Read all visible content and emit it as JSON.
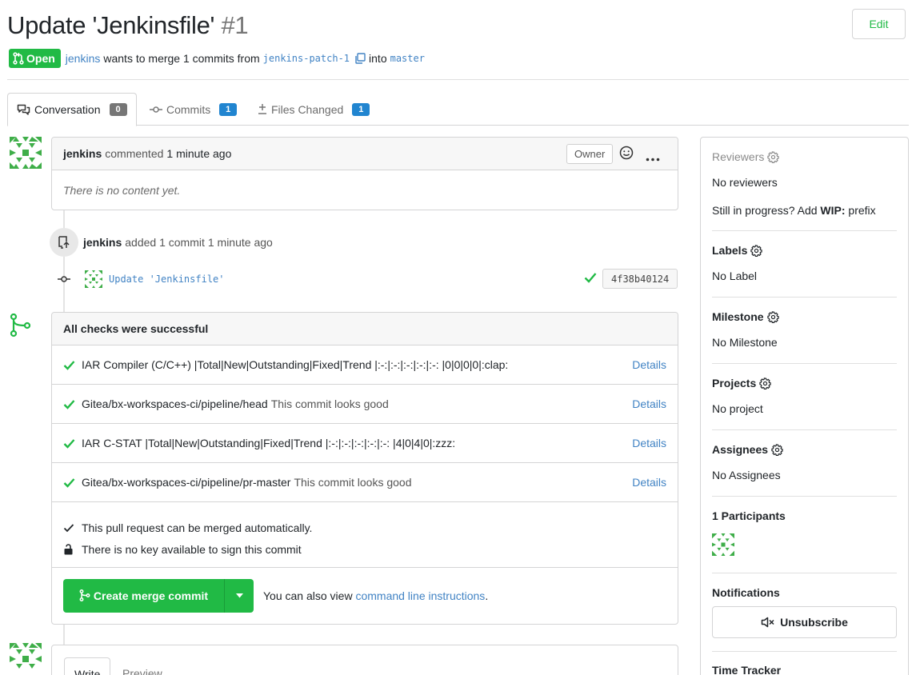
{
  "header": {
    "title": "Update 'Jenkinsfile'",
    "number": "#1",
    "edit_label": "Edit",
    "status": "Open",
    "author": "jenkins",
    "merge_text": "wants to merge 1 commits from",
    "head_branch": "jenkins-patch-1",
    "into_text": "into",
    "base_branch": "master"
  },
  "tabs": [
    {
      "label": "Conversation",
      "count": "0",
      "icon": "conversation-icon",
      "active": true
    },
    {
      "label": "Commits",
      "count": "1",
      "icon": "commit-icon",
      "active": false
    },
    {
      "label": "Files Changed",
      "count": "1",
      "icon": "diff-icon",
      "active": false
    }
  ],
  "comment": {
    "author": "jenkins",
    "action": "commented",
    "time": "1 minute ago",
    "role": "Owner",
    "body": "There is no content yet."
  },
  "commit_event": {
    "author": "jenkins",
    "text": "added 1 commit",
    "time": "1 minute ago",
    "commit_message": "Update 'Jenkinsfile'",
    "sha": "4f38b40124"
  },
  "merge_box": {
    "title": "All checks were successful",
    "checks": [
      {
        "context": "IAR Compiler (C/C++) |Total|New|Outstanding|Fixed|Trend |:-:|:-:|:-:|:-:|:-: |0|0|0|0|:clap:",
        "description": "",
        "details": "Details"
      },
      {
        "context": "Gitea/bx-workspaces-ci/pipeline/head",
        "description": "This commit looks good",
        "details": "Details"
      },
      {
        "context": "IAR C-STAT |Total|New|Outstanding|Fixed|Trend |:-:|:-:|:-:|:-:|:-: |4|0|4|0|:zzz:",
        "description": "",
        "details": "Details"
      },
      {
        "context": "Gitea/bx-workspaces-ci/pipeline/pr-master",
        "description": "This commit looks good",
        "details": "Details"
      }
    ],
    "auto_merge_text": "This pull request can be merged automatically.",
    "sign_text": "There is no key available to sign this commit",
    "merge_button": "Create merge commit",
    "cli_prefix": "You can also view",
    "cli_link": "command line instructions",
    "cli_suffix": "."
  },
  "editor": {
    "write_tab": "Write",
    "preview_tab": "Preview"
  },
  "sidebar": {
    "reviewers_label": "Reviewers",
    "reviewers_value": "No reviewers",
    "wip_prefix": "Still in progress? Add",
    "wip_code": "WIP:",
    "wip_suffix": "prefix",
    "labels_label": "Labels",
    "labels_value": "No Label",
    "milestone_label": "Milestone",
    "milestone_value": "No Milestone",
    "projects_label": "Projects",
    "projects_value": "No project",
    "assignees_label": "Assignees",
    "assignees_value": "No Assignees",
    "participants_label": "1 Participants",
    "notifications_label": "Notifications",
    "unsubscribe_label": "Unsubscribe",
    "time_tracker_label": "Time Tracker"
  },
  "colors": {
    "green": "#21ba45",
    "link": "#4183c4",
    "blue_badge": "#2185d0",
    "grey_badge": "#767676"
  }
}
